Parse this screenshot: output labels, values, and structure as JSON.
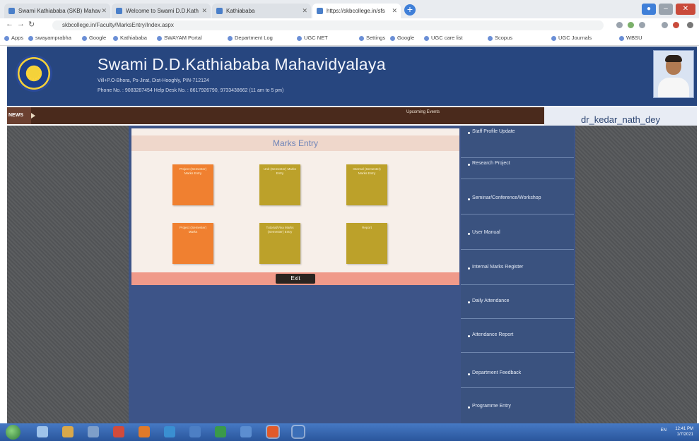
{
  "browser": {
    "tabs": [
      {
        "label": "Swami Kathiababa (SKB) Mahav"
      },
      {
        "label": "Welcome to Swami D.D.Kath"
      },
      {
        "label": "Kathiababa"
      },
      {
        "label": "https://skbcollege.in/sfs"
      }
    ],
    "url": "skbcollege.in/Faculty/MarksEntry/Index.aspx",
    "bookmarks": [
      "Apps",
      "swayamprabha",
      "Google",
      "Kathiababa",
      "SWAYAM Portal",
      "Department Log",
      "UGC NET",
      "Settings",
      "Google",
      "UGC care list",
      "Scopus",
      "UGC Journals",
      "WBSU"
    ]
  },
  "site": {
    "name": "Swami D.D.Kathiababa Mahavidyalaya",
    "address": "Vill+P.O-Bhora, Ps-Jirat, Dist-Hooghly, PIN-712124",
    "phone": "Phone No. : 9083287454    Help Desk No. : 8617926790, 9733438662 (11 am to 5 pm)",
    "news_label": "NEWS",
    "news_text": "Upcoming Events",
    "username": "dr_kedar_nath_dey"
  },
  "marks_entry": {
    "title": "Marks Entry",
    "tiles": [
      {
        "label": "Project (Semester) Marks Entry",
        "color": "#f08030"
      },
      {
        "label": "Unit (Semester) Marks Entry",
        "color": "#bca12a"
      },
      {
        "label": "Internal (Semester) Marks Entry",
        "color": "#bca12a"
      },
      {
        "label": "Project (Semester) Marks",
        "color": "#f08030"
      },
      {
        "label": "Tutorial/Viva Marks (Semester) Entry",
        "color": "#bca12a"
      },
      {
        "label": "Report",
        "color": "#bca12a"
      }
    ],
    "exit_label": "Exit"
  },
  "right_menu": [
    "Staff Profile Update",
    "Research Project",
    "Seminar/Conference/Workshop",
    "User Manual",
    "Internal Marks Register",
    "Daily Attendance",
    "Attendance Report",
    "Department Feedback",
    "Programme Entry"
  ],
  "taskbar": {
    "language": "EN",
    "time": "12:41 PM",
    "date": "1/7/2021"
  },
  "colors": {
    "header": "#27467f",
    "news_bar": "#4a2a1c",
    "panel_title_bg": "#efd7cb",
    "tile_orange": "#f08030",
    "tile_olive": "#bca12a"
  }
}
